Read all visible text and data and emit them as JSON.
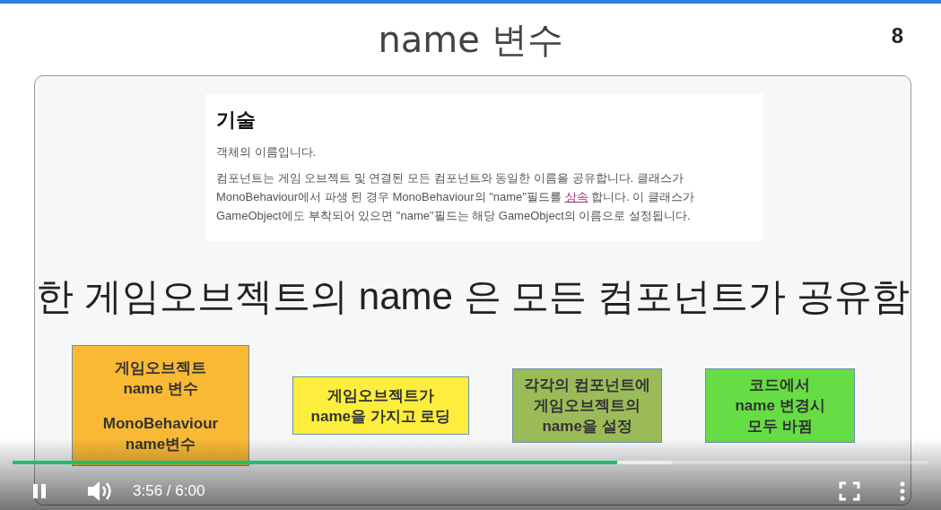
{
  "slide": {
    "title": "name 변수",
    "page_number": "8",
    "doc": {
      "heading": "기술",
      "intro": "객체의 이름입니다.",
      "body": {
        "before": "컴포넌트는 게임 오브젝트 및 연결된 모든 컴포넌트와 동일한 이름을 공유합니다. 클래스가 MonoBehaviour에서 파생 된 경우 MonoBehaviour의 \"name\"필드를 ",
        "link": "상속",
        "after": " 합니다. 이 클래스가 GameObject에도 부착되어 있으면 \"name\"필드는 해당 GameObject의 이름으로 설정됩니다."
      }
    },
    "caption": "한 게임오브젝트의 name  은 모든 컴포넌트가 공유함",
    "boxes": [
      {
        "color": "#f9b935",
        "paragraphs": [
          [
            "게임오브젝트",
            "name 변수"
          ],
          [
            "MonoBehaviour",
            "name변수"
          ]
        ]
      },
      {
        "color": "#fdee3d",
        "paragraphs": [
          [
            "게임오브젝트가",
            "name을 가지고 로딩"
          ]
        ]
      },
      {
        "color": "#9bbb59",
        "paragraphs": [
          [
            "각각의 컴포넌트에",
            "게임오브젝트의",
            "name을 설정"
          ]
        ]
      },
      {
        "color": "#66dd44",
        "paragraphs": [
          [
            "코드에서",
            "name 변경시",
            "모두 바뀜"
          ]
        ]
      }
    ]
  },
  "player": {
    "progress": {
      "level": 0.66
    },
    "playing": true,
    "time": "3:56 / 6:00"
  }
}
